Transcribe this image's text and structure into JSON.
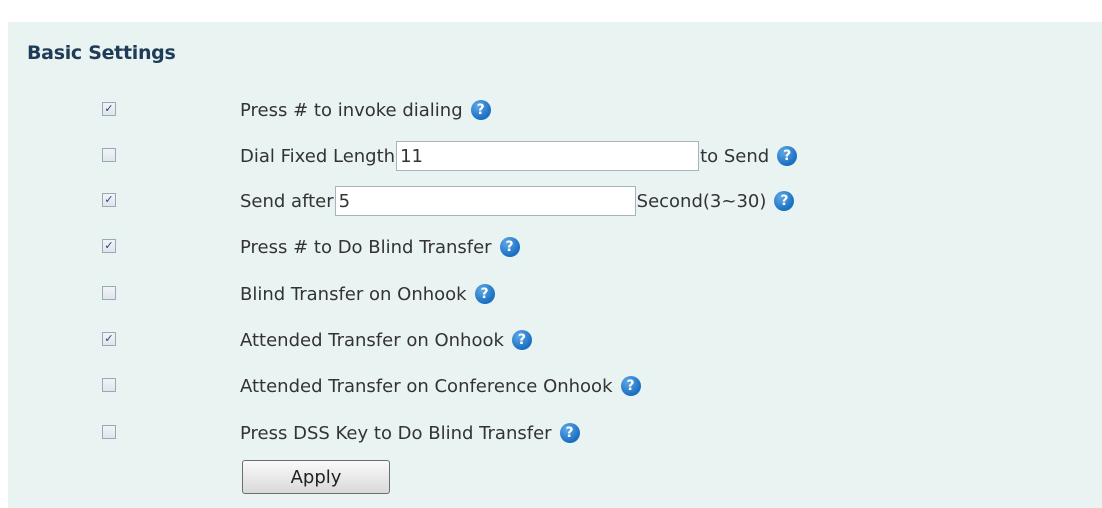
{
  "section": {
    "title": "Basic Settings"
  },
  "rows": [
    {
      "checked": true,
      "check_glyph": "✓",
      "label": "Press # to invoke dialing"
    },
    {
      "checked": false,
      "check_glyph": "",
      "label": "Dial Fixed Length",
      "input_value": "11",
      "suffix": "to Send"
    },
    {
      "checked": true,
      "check_glyph": "✓",
      "label": "Send after",
      "input_value": "5",
      "suffix": "Second(3~30)"
    },
    {
      "checked": true,
      "check_glyph": "✓",
      "label": "Press # to Do Blind Transfer"
    },
    {
      "checked": false,
      "check_glyph": "",
      "label": "Blind Transfer on Onhook"
    },
    {
      "checked": true,
      "check_glyph": "✓",
      "label": "Attended Transfer on Onhook"
    },
    {
      "checked": false,
      "check_glyph": "",
      "label": "Attended Transfer on Conference Onhook"
    },
    {
      "checked": false,
      "check_glyph": "",
      "label": "Press DSS Key to Do Blind Transfer"
    }
  ],
  "help_glyph": "?",
  "help_icon": "question-mark-circle-icon",
  "apply_label": "Apply",
  "colors": {
    "panel_background": "#e9f3f2",
    "title": "#1f3b57",
    "help_icon": "#1a6fc1"
  }
}
